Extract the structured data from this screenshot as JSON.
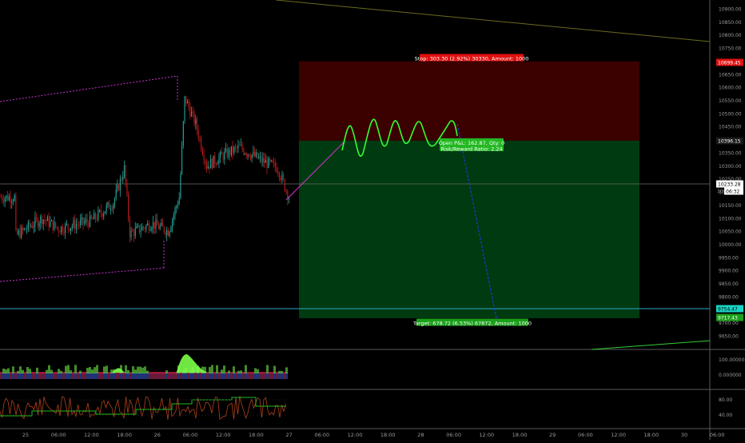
{
  "colors": {
    "background": "#000000",
    "up_candle": "#26a69a",
    "down_candle": "#b71c1c",
    "stop_zone": "#3b0000",
    "target_zone": "#003a10",
    "stop_label": "#e01010",
    "target_label": "#1aa01a",
    "pnl_label": "#22b822",
    "projection": "#33ff33",
    "down_projection": "#1e3cff",
    "channel": "#cc33cc",
    "trendline": "#6a6a1e",
    "horizontal_line": "#2aa8c8",
    "indicator_green": "#7cff4a",
    "indicator_red": "#ff2050"
  },
  "price_axis": {
    "ticks": [
      "10900.00",
      "10850.00",
      "10800.00",
      "10750.00",
      "10700.00",
      "10650.00",
      "10600.00",
      "10550.00",
      "10500.00",
      "10450.00",
      "10400.00",
      "10350.00",
      "10300.00",
      "10250.00",
      "10200.00",
      "10150.00",
      "10100.00",
      "10050.00",
      "10000.00",
      "9950.00",
      "9900.00",
      "9850.00",
      "9800.00",
      "9750.00",
      "9700.00",
      "9650.00"
    ],
    "tick_values": [
      10900,
      10850,
      10800,
      10750,
      10700,
      10650,
      10600,
      10550,
      10500,
      10450,
      10400,
      10350,
      10300,
      10250,
      10200,
      10150,
      10100,
      10050,
      10000,
      9950,
      9900,
      9850,
      9800,
      9750,
      9700,
      9650
    ],
    "stop_price_label": "10699.45",
    "entry_price_label": "10396.15",
    "current_price_label": "10233.28",
    "countdown_label": "06:32",
    "hline_price_label": "9754.47",
    "target_price_label": "9717.43",
    "extra_label": "10"
  },
  "osc_axis": {
    "ticks": [
      "100.000000",
      "0.000000"
    ]
  },
  "rsi_axis": {
    "ticks": [
      "80.00",
      "40.00"
    ]
  },
  "time_axis": {
    "ticks": [
      "25",
      "06:00",
      "12:00",
      "18:00",
      "26",
      "06:00",
      "12:00",
      "18:00",
      "27",
      "06:00",
      "12:00",
      "18:00",
      "28",
      "06:00",
      "12:00",
      "18:00",
      "29",
      "06:00",
      "12:00",
      "18:00",
      "30",
      "06:00"
    ]
  },
  "position": {
    "type": "short",
    "entry": 10396.15,
    "stop": 10699.45,
    "target": 9717.43,
    "stop_label": "Stop: 303.30 (2.92%) 30330, Amount: 1000",
    "target_label": "Target: 678.72 (6.53%) 67872, Amount: 1000",
    "pnl_line1": "Open P&L: 162.87, Qty: 0",
    "pnl_line2": "Risk/Reward Ratio: 2.24"
  },
  "chart_data": {
    "type": "candlestick",
    "symbol_interval": "15m",
    "ylim": [
      9625,
      10950
    ],
    "last_price": 10233.28,
    "horizontal_line": 9754.47,
    "x_range": [
      "25 00:00",
      "30 06:00"
    ],
    "price_path_waypoints": [
      {
        "t": "24 22:00",
        "p": 10030
      },
      {
        "t": "25 03:00",
        "p": 10100
      },
      {
        "t": "25 06:00",
        "p": 10060
      },
      {
        "t": "25 12:00",
        "p": 10090
      },
      {
        "t": "25 16:00",
        "p": 10160
      },
      {
        "t": "25 18:00",
        "p": 10290
      },
      {
        "t": "25 19:00",
        "p": 10040
      },
      {
        "t": "25 23:00",
        "p": 10080
      },
      {
        "t": "26 02:00",
        "p": 10050
      },
      {
        "t": "26 04:00",
        "p": 10180
      },
      {
        "t": "26 05:00",
        "p": 10560
      },
      {
        "t": "26 07:00",
        "p": 10460
      },
      {
        "t": "26 09:00",
        "p": 10300
      },
      {
        "t": "26 12:00",
        "p": 10340
      },
      {
        "t": "26 15:00",
        "p": 10370
      },
      {
        "t": "26 19:00",
        "p": 10320
      },
      {
        "t": "26 22:00",
        "p": 10290
      },
      {
        "t": "27 00:00",
        "p": 10180
      }
    ]
  }
}
